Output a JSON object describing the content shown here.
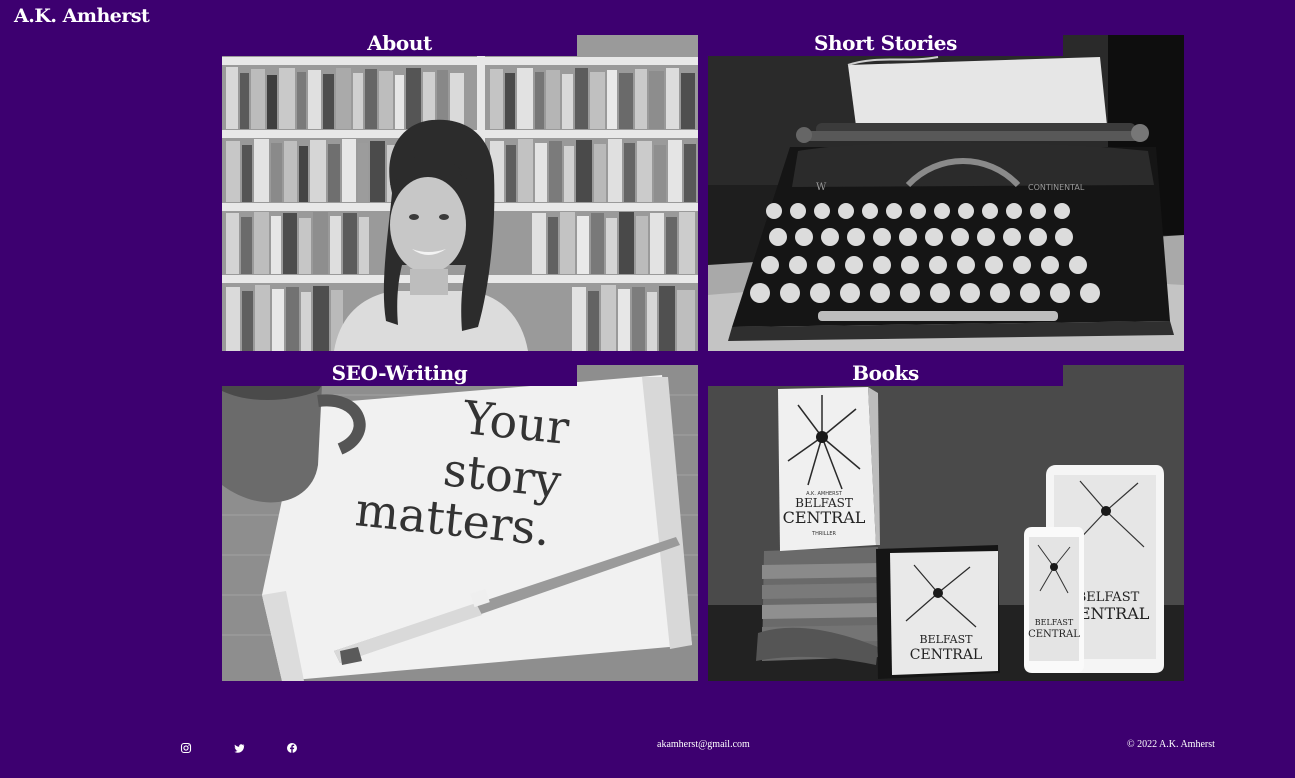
{
  "header": {
    "site_title": "A.K. Amherst"
  },
  "tiles": [
    {
      "label": "About",
      "image": "author-portrait-bookshelf"
    },
    {
      "label": "Short Stories",
      "image": "vintage-typewriter"
    },
    {
      "label": "SEO-Writing",
      "image": "napkin-note-and-pen",
      "napkin_text": [
        "Your",
        "story",
        "matters."
      ]
    },
    {
      "label": "Books",
      "image": "book-cover-product-mockups",
      "book_cover": {
        "author": "A.K. AMHERST",
        "title_line1": "BELFAST",
        "title_line2": "CENTRAL",
        "genre": "THRILLER"
      }
    }
  ],
  "footer": {
    "social": [
      "instagram-icon",
      "twitter-icon",
      "facebook-icon"
    ],
    "email": "akamherst@gmail.com",
    "copyright": "© 2022 A.K. Amherst"
  },
  "colors": {
    "background": "#3d0070",
    "text": "#ffffff"
  }
}
